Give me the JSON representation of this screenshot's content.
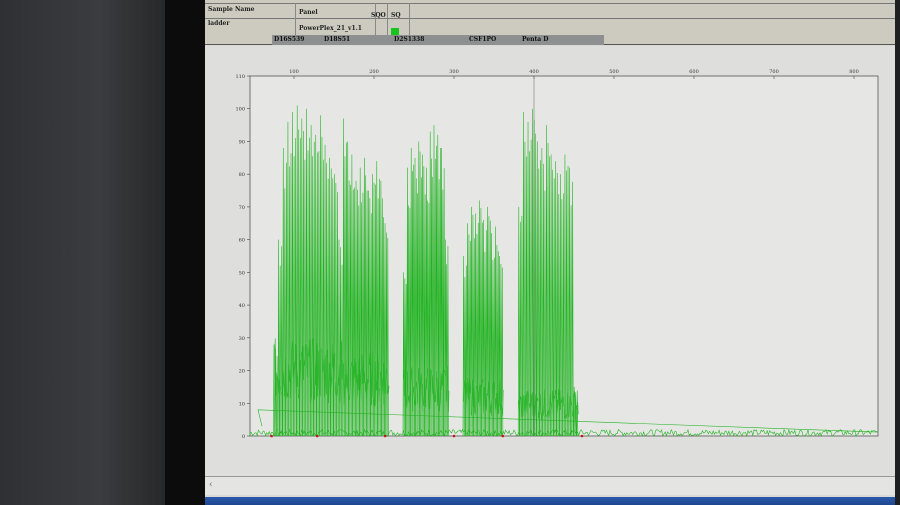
{
  "header": {
    "col_sample_name": "Sample Name",
    "col_panel": "Panel",
    "col_sqo": "SQO",
    "col_sq": "SQ",
    "row_sample": "ladder",
    "row_panel": "PowerPlex_21_v1.1",
    "status_color": "#19c31e"
  },
  "markers": [
    "D16S539",
    "D18S51",
    "D2S1338",
    "CSF1PO",
    "Penta D"
  ],
  "chart_data": {
    "type": "line",
    "title": "",
    "xlabel": "",
    "ylabel": "",
    "xlim": [
      45,
      830
    ],
    "ylim": [
      0,
      110
    ],
    "x_ticks": [
      100,
      200,
      300,
      400,
      500,
      600,
      700,
      800
    ],
    "y_ticks": [
      0,
      10,
      20,
      30,
      40,
      50,
      60,
      70,
      80,
      90,
      100,
      110
    ],
    "series_color": "#22b322",
    "clusters": [
      {
        "start": 75,
        "end": 162,
        "shoulder": 25,
        "peaks": [
          28,
          60,
          88,
          96,
          99,
          101,
          97,
          100,
          95,
          92,
          98,
          89,
          85,
          80,
          60
        ]
      },
      {
        "start": 162,
        "end": 219,
        "shoulder": 22,
        "peaks": [
          97,
          90,
          86,
          78,
          82,
          85,
          75,
          80,
          84,
          78,
          65
        ]
      },
      {
        "start": 237,
        "end": 294,
        "shoulder": 18,
        "peaks": [
          50,
          82,
          88,
          85,
          90,
          86,
          82,
          93,
          95,
          92,
          88,
          60
        ]
      },
      {
        "start": 312,
        "end": 362,
        "shoulder": 15,
        "peaks": [
          55,
          65,
          70,
          68,
          72,
          66,
          70,
          62,
          64,
          55
        ]
      },
      {
        "start": 381,
        "end": 456,
        "shoulder": 12,
        "peaks": [
          70,
          99,
          96,
          100,
          90,
          88,
          95,
          86,
          84,
          80,
          86,
          82,
          15
        ]
      }
    ],
    "baseline_noise": 2,
    "allele_markers_bp": [
      72,
      129,
      214,
      300,
      361,
      460
    ],
    "cursor_bp": 400
  }
}
